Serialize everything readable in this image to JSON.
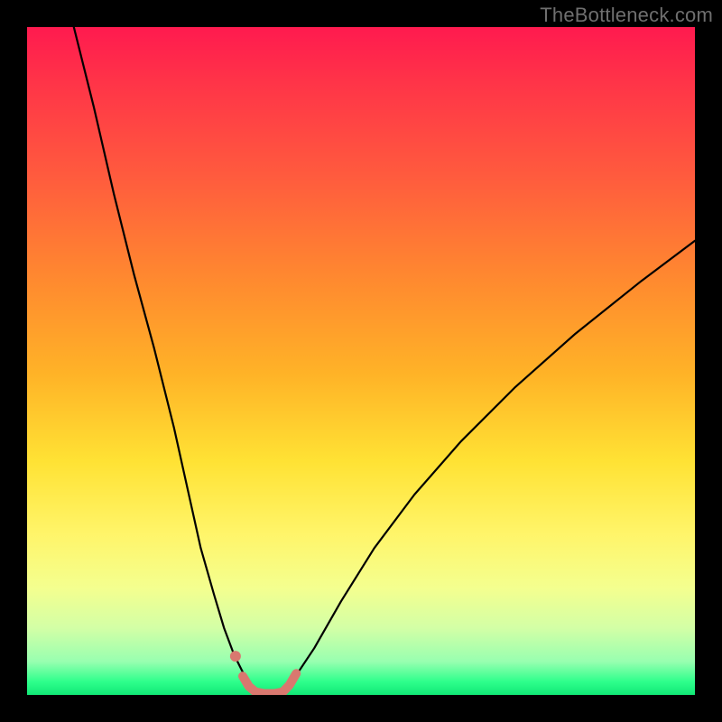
{
  "watermark": "TheBottleneck.com",
  "chart_data": {
    "type": "line",
    "title": "",
    "xlabel": "",
    "ylabel": "",
    "xlim": [
      0,
      100
    ],
    "ylim": [
      0,
      100
    ],
    "background": {
      "top_color": "#ff1744",
      "bottom_color": "#11e876",
      "meaning": "red = bad / bottleneck, green = good / balanced"
    },
    "series": [
      {
        "name": "left-branch",
        "x": [
          7,
          10,
          13,
          16,
          19,
          22,
          24,
          26,
          28,
          29.5,
          31,
          32.5,
          33.5,
          34.5
        ],
        "y": [
          100,
          88,
          75,
          63,
          52,
          40,
          31,
          22,
          15,
          10,
          6,
          3,
          1.2,
          0.3
        ]
      },
      {
        "name": "right-branch",
        "x": [
          38,
          40,
          43,
          47,
          52,
          58,
          65,
          73,
          82,
          92,
          100
        ],
        "y": [
          0.3,
          2.5,
          7,
          14,
          22,
          30,
          38,
          46,
          54,
          62,
          68
        ]
      },
      {
        "name": "floor-segment",
        "x": [
          34.5,
          36,
          38
        ],
        "y": [
          0.3,
          0.15,
          0.3
        ]
      }
    ],
    "markers": [
      {
        "name": "highlight-dot-left",
        "x": 31.2,
        "y": 5.8,
        "color": "#d9786f",
        "r": 6
      }
    ],
    "highlight_path": {
      "name": "valley-highlight",
      "color": "#d9786f",
      "width": 10,
      "x": [
        32.3,
        33.2,
        34.2,
        35.5,
        37,
        38.3,
        39.3,
        40.3
      ],
      "y": [
        2.8,
        1.3,
        0.45,
        0.2,
        0.2,
        0.45,
        1.5,
        3.2
      ]
    }
  }
}
